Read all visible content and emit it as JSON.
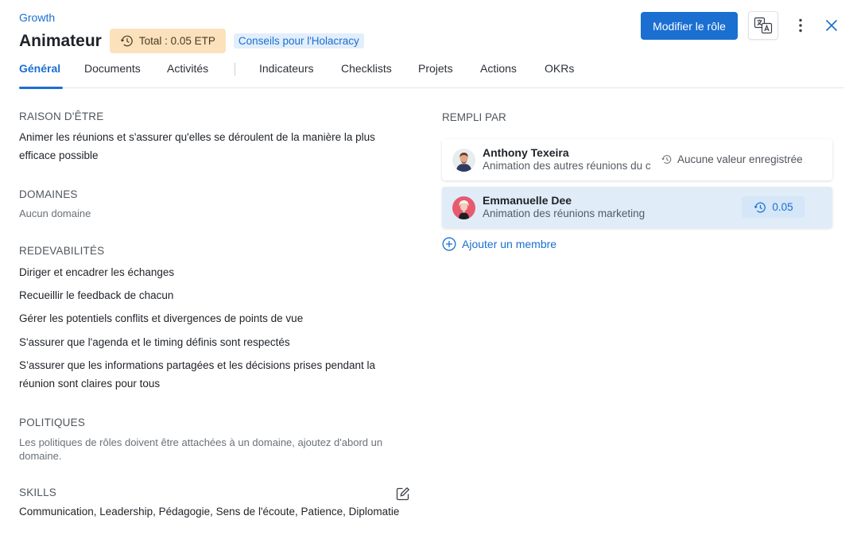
{
  "header": {
    "breadcrumb": "Growth",
    "title": "Animateur",
    "etp_badge": "Total : 0.05 ETP",
    "tips_link": "Conseils pour l'Holacracy",
    "edit_button": "Modifier le rôle"
  },
  "tabs": [
    {
      "label": "Général",
      "active": true
    },
    {
      "label": "Documents"
    },
    {
      "label": "Activités"
    },
    {
      "label": "Indicateurs"
    },
    {
      "label": "Checklists"
    },
    {
      "label": "Projets"
    },
    {
      "label": "Actions"
    },
    {
      "label": "OKRs"
    }
  ],
  "purpose": {
    "heading": "RAISON D'ÊTRE",
    "text": "Animer les réunions et s'assurer qu'elles se déroulent de la manière la plus efficace possible"
  },
  "domains": {
    "heading": "DOMAINES",
    "text": "Aucun domaine"
  },
  "accountabilities": {
    "heading": "REDEVABILITÉS",
    "items": [
      "Diriger et encadrer les échanges",
      "Recueillir le feedback de chacun",
      "Gérer les potentiels conflits et divergences de points de vue",
      "S'assurer que l'agenda et le timing définis sont respectés",
      "S’assurer que les informations partagées et les décisions prises pendant la réunion sont claires pour tous"
    ]
  },
  "policies": {
    "heading": "POLITIQUES",
    "text": "Les politiques de rôles doivent être attachées à un domaine, ajoutez d'abord un domaine."
  },
  "skills": {
    "heading": "SKILLS",
    "text": "Communication, Leadership, Pédagogie, Sens de l'écoute, Patience, Diplomatie"
  },
  "filled_by": {
    "heading": "REMPLI PAR",
    "members": [
      {
        "name": "Anthony Texeira",
        "description": "Animation des autres réunions du c",
        "value": "Aucune valeur enregistrée"
      },
      {
        "name": "Emmanuelle Dee",
        "description": "Animation des réunions marketing",
        "value": "0.05"
      }
    ],
    "add_label": "Ajouter un membre"
  },
  "colors": {
    "accent": "#1a6fd1",
    "etp_badge_bg": "#fbe2bd",
    "selected_card_bg": "#e0ecf8"
  }
}
